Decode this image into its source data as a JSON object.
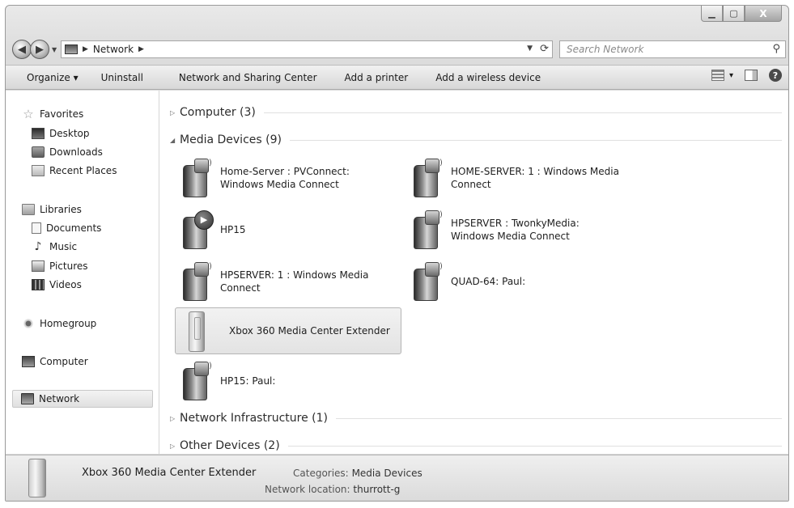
{
  "window": {
    "caption": {
      "minimize": "▁",
      "maximize": "▢",
      "close": "X"
    }
  },
  "address": {
    "crumb": "Network",
    "placeholder_search": "Search Network"
  },
  "commands": {
    "organize": "Organize ▾",
    "uninstall": "Uninstall",
    "network_sharing": "Network and Sharing Center",
    "add_printer": "Add a printer",
    "add_wireless": "Add a wireless device",
    "views_dropdown": "▾"
  },
  "nav": {
    "favorites": "Favorites",
    "desktop": "Desktop",
    "downloads": "Downloads",
    "recent_places": "Recent Places",
    "libraries": "Libraries",
    "documents": "Documents",
    "music": "Music",
    "pictures": "Pictures",
    "videos": "Videos",
    "homegroup": "Homegroup",
    "computer": "Computer",
    "network": "Network"
  },
  "groups": {
    "computer": "Computer (3)",
    "media_devices": "Media Devices (9)",
    "network_infrastructure": "Network Infrastructure (1)",
    "other_devices": "Other Devices (2)"
  },
  "devices": [
    {
      "line1": "Home-Server : PVConnect:",
      "line2": "Windows Media Connect",
      "icon": "media-server-icon"
    },
    {
      "line1": "HOME-SERVER: 1 : Windows Media",
      "line2": "Connect",
      "icon": "media-server-icon"
    },
    {
      "line1": "HP15",
      "line2": "",
      "icon": "media-player-icon"
    },
    {
      "line1": "HPSERVER : TwonkyMedia:",
      "line2": "Windows Media Connect",
      "icon": "media-server-icon"
    },
    {
      "line1": "HPSERVER: 1 : Windows Media",
      "line2": "Connect",
      "icon": "media-server-icon"
    },
    {
      "line1": "QUAD-64: Paul:",
      "line2": "",
      "icon": "media-server-icon"
    },
    {
      "line1": "Xbox 360 Media Center Extender",
      "line2": "",
      "icon": "xbox-icon"
    },
    {
      "line1": "HP15: Paul:",
      "line2": "",
      "icon": "media-server-icon"
    }
  ],
  "details": {
    "name": "Xbox 360 Media Center Extender",
    "categories_label": "Categories:",
    "categories_value": "Media Devices",
    "location_label": "Network location:",
    "location_value": "thurrott-g"
  }
}
